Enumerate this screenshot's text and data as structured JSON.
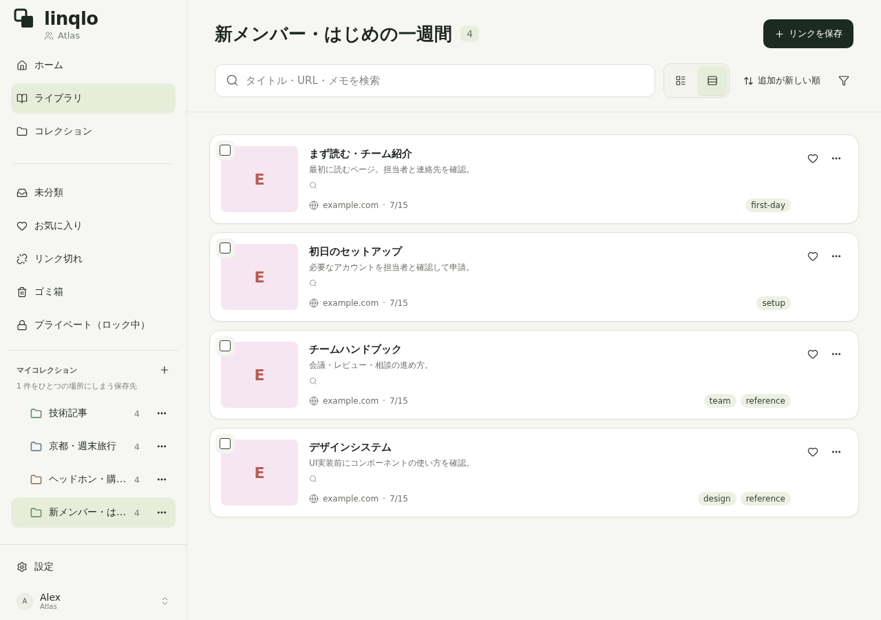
{
  "brand": {
    "name": "linqlo",
    "workspace": "Atlas"
  },
  "nav": [
    {
      "kind": "home",
      "label": "ホーム",
      "selected": false
    },
    {
      "kind": "library",
      "label": "ライブラリ",
      "selected": true
    },
    {
      "kind": "collection",
      "label": "コレクション",
      "selected": false
    }
  ],
  "filters": [
    {
      "kind": "inbox",
      "label": "未分類"
    },
    {
      "kind": "heart",
      "label": "お気に入り"
    },
    {
      "kind": "broken",
      "label": "リンク切れ"
    },
    {
      "kind": "trash",
      "label": "ゴミ箱"
    },
    {
      "kind": "lock",
      "label": "プライベート（ロック中）"
    }
  ],
  "my_collections": {
    "title": "マイコレクション",
    "subtitle": "1 件をひとつの場所にしまう保存先",
    "items": [
      {
        "name": "技術記事",
        "count": "4",
        "color": "#6b8f71",
        "selected": false
      },
      {
        "name": "京都・週末旅行",
        "count": "4",
        "color": "#6b7f99",
        "selected": false
      },
      {
        "name": "ヘッドホン・購…",
        "count": "4",
        "color": "#9a7b62",
        "selected": false
      },
      {
        "name": "新メンバー・は…",
        "count": "4",
        "color": "#6b8f71",
        "selected": true
      }
    ]
  },
  "settings": "設定",
  "user": {
    "initial": "A",
    "name": "Alex",
    "workspace": "Atlas"
  },
  "header": {
    "title": "新メンバー・はじめの一週間",
    "count": "4",
    "save_button": "リンクを保存"
  },
  "search": {
    "placeholder": "タイトル・URL・メモを検索"
  },
  "views": [
    {
      "kind": "compact",
      "selected": false
    },
    {
      "kind": "list",
      "selected": true
    }
  ],
  "sort": "追加が新しい順",
  "meta_separator": "·",
  "links": [
    {
      "thumb": "E",
      "title": "まず読む・チーム紹介",
      "description": "最初に読むページ。担当者と連絡先を確認。",
      "domain": "example.com",
      "date": "7/15",
      "tags": [
        "first-day"
      ],
      "checked": false,
      "favorite": false
    },
    {
      "thumb": "E",
      "title": "初日のセットアップ",
      "description": "必要なアカウントを担当者と確認して申請。",
      "domain": "example.com",
      "date": "7/15",
      "tags": [
        "setup"
      ],
      "checked": false,
      "favorite": false
    },
    {
      "thumb": "E",
      "title": "チームハンドブック",
      "description": "会議・レビュー・相談の進め方。",
      "domain": "example.com",
      "date": "7/15",
      "tags": [
        "team",
        "reference"
      ],
      "checked": false,
      "favorite": false
    },
    {
      "thumb": "E",
      "title": "デザインシステム",
      "description": "UI実装前にコンポーネントの使い方を確認。",
      "domain": "example.com",
      "date": "7/15",
      "tags": [
        "design",
        "reference"
      ],
      "checked": false,
      "favorite": false
    }
  ]
}
